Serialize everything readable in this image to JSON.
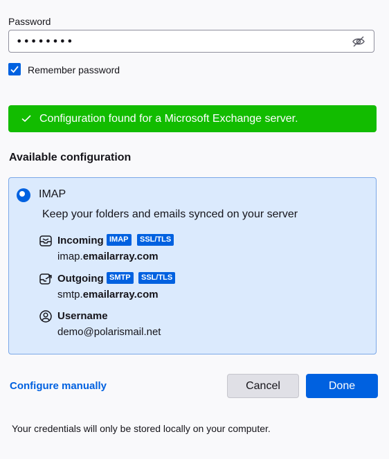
{
  "password": {
    "label": "Password",
    "value": "••••••••",
    "toggle_icon": "eye-slash-icon"
  },
  "remember": {
    "label": "Remember password",
    "checked": true
  },
  "banner": {
    "text": "Configuration found for a Microsoft Exchange server.",
    "color": "#12bc00"
  },
  "section_title": "Available configuration",
  "option": {
    "protocol": "IMAP",
    "description": "Keep your folders and emails synced on your server",
    "incoming": {
      "label": "Incoming",
      "badges": [
        "IMAP",
        "SSL/TLS"
      ],
      "host_prefix": "imap.",
      "host_domain": "emailarray.com"
    },
    "outgoing": {
      "label": "Outgoing",
      "badges": [
        "SMTP",
        "SSL/TLS"
      ],
      "host_prefix": "smtp.",
      "host_domain": "emailarray.com"
    },
    "username": {
      "label": "Username",
      "value": "demo@polarismail.net"
    }
  },
  "actions": {
    "configure_manually": "Configure manually",
    "cancel": "Cancel",
    "done": "Done"
  },
  "footer": "Your credentials will only be stored locally on your computer.",
  "colors": {
    "accent": "#0061e0",
    "card_bg": "#dbeafd"
  }
}
